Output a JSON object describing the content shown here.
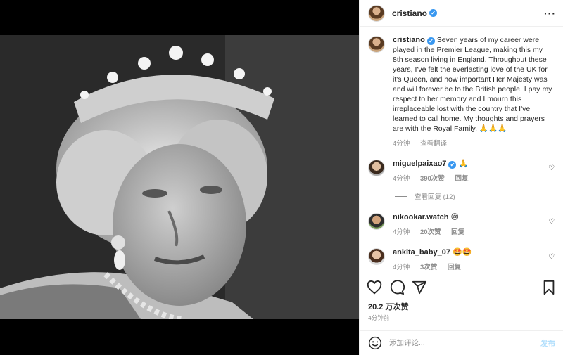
{
  "post": {
    "username": "cristiano",
    "verified_mark": "✔",
    "more_label": "···",
    "caption_user": "cristiano",
    "caption": "Seven years of my career were played in the Premier League, making this my 8th season living in England. Throughout these years, I've felt the everlasting love of the UK for it's Queen, and how important Her Majesty was and will forever be to the British people. I pay my respect to her memory and I mourn this irreplaceable lost with the country that I've learned to call home. My thoughts and prayers are with the Royal Family. 🙏🙏🙏",
    "caption_time": "4分钟",
    "see_translation": "查看翻译",
    "likes": "20.2 万次赞",
    "posted_time": "4分钟前"
  },
  "comments": [
    {
      "username": "miguelpaixao7",
      "verified": true,
      "text": "🙏",
      "time": "4分钟",
      "likes": "390次赞",
      "reply": "回复",
      "view_replies": "查看回复 (12)"
    },
    {
      "username": "nikookar.watch",
      "verified": false,
      "text": "😢",
      "time": "4分钟",
      "likes": "20次赞",
      "reply": "回复"
    },
    {
      "username": "ankita_baby_07",
      "verified": false,
      "text": "🤩🤩",
      "time": "4分钟",
      "likes": "3次赞",
      "reply": "回复"
    }
  ],
  "composer": {
    "placeholder": "添加评论...",
    "post_label": "发布"
  },
  "icons": {
    "heart": "heart-icon",
    "comment": "comment-icon",
    "share": "share-icon",
    "bookmark": "bookmark-icon",
    "emoji": "emoji-icon"
  },
  "colors": {
    "verified": "#3897f0",
    "muted": "#8e8e8e",
    "post_disabled": "#b2dffc"
  }
}
